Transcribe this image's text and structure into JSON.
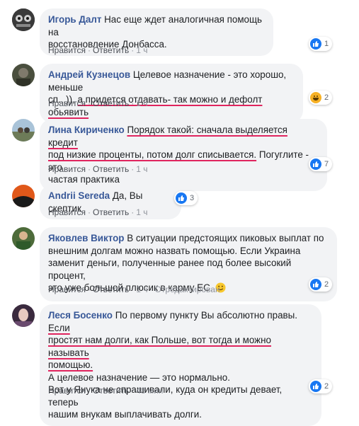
{
  "actions": {
    "like": "Нравится",
    "reply": "Ответить",
    "edited": "Отредактирован"
  },
  "comments": [
    {
      "author": "Игорь Далт",
      "text_lines": [
        "Нас еще ждет аналогичная помощь на",
        "восстановление Донбасса."
      ],
      "time": "1 ч",
      "reactions": {
        "type": "like",
        "count": "1"
      }
    },
    {
      "author": "Андрей Кузнецов",
      "line1_rest": "Целевое назначение - это хорошо, меньше",
      "line2_plain": "сп...)),",
      "line2_marked": "а придется отдавать- так можно и дефолт обьявить",
      "time": "1 ч",
      "reactions": {
        "type": "like+haha",
        "count": "2"
      }
    },
    {
      "author": "Лина Кириченко",
      "line1_marked": "Порядок такой: сначала выделяется кредит",
      "line2_marked": "под низкие проценты, потом долг списывается.",
      "line2_rest": "Погуглите - это",
      "line3": "частая практика",
      "time": "1 ч",
      "reactions": {
        "type": "like",
        "count": "7"
      }
    },
    {
      "author": "Andrii Sereda",
      "text": "Да, Вы скептик",
      "time": "1 ч",
      "reactions": {
        "type": "like",
        "count": "3"
      }
    },
    {
      "author": "Яковлев Виктор",
      "text_lines": [
        "В ситуации предстоящих пиковых выплат по",
        "внешним долгам можно назвать помощью. Если Украина",
        "заменит деньги, полученные ранее под более высокий процент,",
        "это уже большой плюсик в карму ЕС."
      ],
      "emoji": "smile-emoji",
      "time": "1 ч",
      "reactions": {
        "type": "like",
        "count": "2"
      }
    },
    {
      "author": "Леся Босенко",
      "line1_rest": "По первому пункту Вы абсолютно правы.",
      "line1_marked": "Если",
      "line2_marked": "простят нам долги, как Польше, вот тогда и можно называть",
      "line3_marked": "помощью.",
      "text_lines": [
        "А целевое назначение — это нормально.",
        "Вот у Янука не спрашивали, куда он кредиты девает, теперь",
        "нашим внукам выплачивать долги."
      ],
      "time": "48 мин",
      "reactions": {
        "type": "like",
        "count": "2"
      }
    }
  ],
  "colors": {
    "author": "#385898",
    "bubble": "#f2f3f5",
    "underline": "#e0245e",
    "like": "#1877f2"
  }
}
